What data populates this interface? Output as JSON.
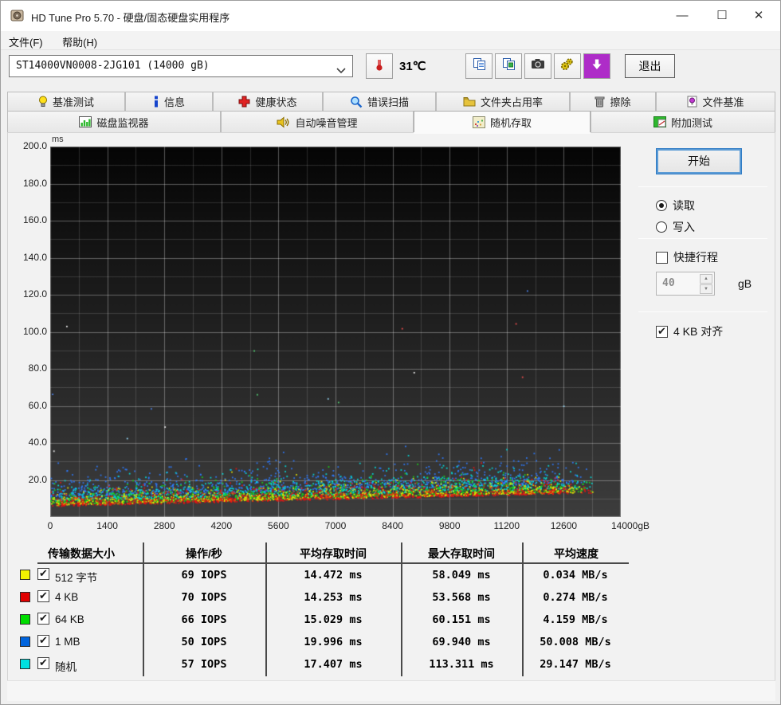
{
  "window": {
    "title": "HD Tune Pro 5.70 - 硬盘/固态硬盘实用程序",
    "controls": {
      "minimize": "—",
      "maximize": "☐",
      "close": "✕"
    }
  },
  "menu": {
    "items": [
      {
        "label": "文件(F)"
      },
      {
        "label": "帮助(H)"
      }
    ]
  },
  "toolbar": {
    "drive_selected": "ST14000VN0008-2JG101 (14000 gB)",
    "temperature": "31℃",
    "exit_label": "退出",
    "download_glyph": "↓",
    "chevron_glyph": "∨"
  },
  "tabs": {
    "active": "随机存取",
    "row1": [
      {
        "label": "基准测试"
      },
      {
        "label": "信息"
      },
      {
        "label": "健康状态"
      },
      {
        "label": "错误扫描"
      },
      {
        "label": "文件夹占用率"
      },
      {
        "label": "擦除"
      },
      {
        "label": "文件基准"
      }
    ],
    "row2": [
      {
        "label": "磁盘监视器"
      },
      {
        "label": "自动噪音管理"
      },
      {
        "label": "随机存取"
      },
      {
        "label": "附加测试"
      }
    ]
  },
  "controls": {
    "start_label": "开始",
    "read_label": "读取",
    "read_selected": true,
    "write_label": "写入",
    "write_selected": false,
    "short_stroke_label": "快捷行程",
    "short_stroke_checked": false,
    "short_stroke_value": "40",
    "short_stroke_unit": "gB",
    "align_label": "4 KB 对齐",
    "align_checked": true,
    "spin_up": "▲",
    "spin_dn": "▼"
  },
  "table": {
    "headers": [
      "传输数据大小",
      "操作/秒",
      "平均存取时间",
      "最大存取时间",
      "平均速度"
    ],
    "rows": [
      {
        "color": "#f2f200",
        "checked": true,
        "label": "512 字节",
        "iops": "69 IOPS",
        "avg": "14.472 ms",
        "max": "58.049 ms",
        "speed": "0.034 MB/s"
      },
      {
        "color": "#e00000",
        "checked": true,
        "label": "4 KB",
        "iops": "70 IOPS",
        "avg": "14.253 ms",
        "max": "53.568 ms",
        "speed": "0.274 MB/s"
      },
      {
        "color": "#00dd00",
        "checked": true,
        "label": "64 KB",
        "iops": "66 IOPS",
        "avg": "15.029 ms",
        "max": "60.151 ms",
        "speed": "4.159 MB/s"
      },
      {
        "color": "#0064dd",
        "checked": true,
        "label": "1 MB",
        "iops": "50 IOPS",
        "avg": "19.996 ms",
        "max": "69.940 ms",
        "speed": "50.008 MB/s"
      },
      {
        "color": "#00e0e0",
        "checked": true,
        "label": "随机",
        "iops": "57 IOPS",
        "avg": "17.407 ms",
        "max": "113.311 ms",
        "speed": "29.147 MB/s"
      }
    ]
  },
  "chart_data": {
    "type": "scatter",
    "title": "随机存取 — 存取时间散点图 (access time vs. disk position)",
    "ylabel": "ms",
    "xlabel": "gB",
    "x_range": [
      0,
      14000
    ],
    "y_range": [
      0,
      200
    ],
    "x_ticks": [
      {
        "v": 0,
        "label": "0"
      },
      {
        "v": 1400,
        "label": "1400"
      },
      {
        "v": 2800,
        "label": "2800"
      },
      {
        "v": 4200,
        "label": "4200"
      },
      {
        "v": 5600,
        "label": "5600"
      },
      {
        "v": 7000,
        "label": "7000"
      },
      {
        "v": 8400,
        "label": "8400"
      },
      {
        "v": 9800,
        "label": "9800"
      },
      {
        "v": 11200,
        "label": "11200"
      },
      {
        "v": 12600,
        "label": "12600"
      },
      {
        "v": 14000,
        "label": "14000gB"
      }
    ],
    "y_ticks": [
      {
        "v": 200,
        "label": "200.0"
      },
      {
        "v": 180,
        "label": "180.0"
      },
      {
        "v": 160,
        "label": "160.0"
      },
      {
        "v": 140,
        "label": "140.0"
      },
      {
        "v": 120,
        "label": "120.0"
      },
      {
        "v": 100,
        "label": "100.0"
      },
      {
        "v": 80,
        "label": "80.0"
      },
      {
        "v": 60,
        "label": "60.0"
      },
      {
        "v": 40,
        "label": "40.0"
      },
      {
        "v": 20,
        "label": "20.0"
      }
    ],
    "x_minor_step": 700,
    "y_minor_step": 10,
    "y_major_step": 20,
    "grid": true,
    "x_data_end": 13350,
    "legend_position": "table-below",
    "series": [
      {
        "name": "1 MB",
        "color": "#2e7bff",
        "count": 950,
        "y_start": 11,
        "y_end": 19,
        "spread": 9,
        "avg_ms": 19.996,
        "max_ms": 69.94
      },
      {
        "name": "随机",
        "color": "#00e0e0",
        "count": 900,
        "y_start": 9,
        "y_end": 16,
        "spread": 7,
        "avg_ms": 17.407,
        "max_ms": 113.311
      },
      {
        "name": "64 KB",
        "color": "#19d419",
        "count": 950,
        "y_start": 7,
        "y_end": 14.5,
        "spread": 5.5,
        "avg_ms": 15.029,
        "max_ms": 60.151
      },
      {
        "name": "512 字节",
        "color": "#e8e800",
        "count": 900,
        "y_start": 6.5,
        "y_end": 14,
        "spread": 5,
        "avg_ms": 14.472,
        "max_ms": 58.049
      },
      {
        "name": "4 KB",
        "color": "#e81414",
        "count": 950,
        "y_start": 6,
        "y_end": 13.5,
        "spread": 5,
        "avg_ms": 14.253,
        "max_ms": 53.568
      }
    ],
    "outliers": {
      "count": 16,
      "y_min": 35,
      "y_max": 125,
      "colors": [
        "#ffffff",
        "#9adfff",
        "#ff5050",
        "#58e07a",
        "#4f8bff"
      ]
    },
    "background": {
      "top": "#050505",
      "bottom": "#3d3d3d"
    }
  }
}
